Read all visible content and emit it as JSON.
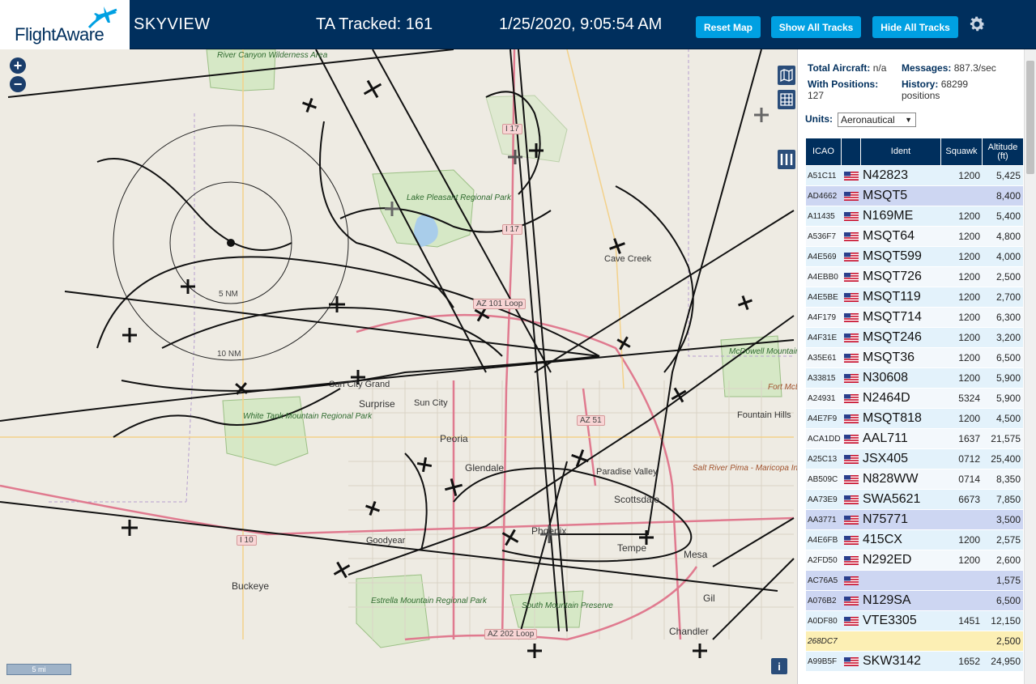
{
  "header": {
    "logo_text": "FlightAware",
    "app_title": "SKYVIEW",
    "tracked": "TA Tracked: 161",
    "clock": "1/25/2020, 9:05:54 AM",
    "reset_label": "Reset Map",
    "show_label": "Show All Tracks",
    "hide_label": "Hide All Tracks",
    "gear_icon": "gear-icon"
  },
  "map": {
    "zoom_in": "+",
    "zoom_out": "−",
    "scale": "5 mi",
    "info": "i",
    "cities": [
      "Surprise",
      "Sun City",
      "Peoria",
      "Glendale",
      "Paradise Valley",
      "Scottsdale",
      "Phoenix",
      "Tempe",
      "Mesa",
      "Goodyear",
      "Buckeye",
      "Chandler",
      "Sun City Grand",
      "Fountain Hills",
      "Cave Creek",
      "Gil"
    ],
    "parks": [
      "River Canyon Wilderness Area",
      "Lake Pleasant Regional Park",
      "White Tank Mountain Regional Park",
      "Estrella Mountain Regional Park",
      "South Mountain Preserve",
      "McDowell Mountain Regional Park",
      "Salt River Pima - Maricopa Indian Community",
      "Fort McDowell Yavapai Nation"
    ],
    "roads": [
      "I 17",
      "I 17",
      "I 10",
      "AZ 51",
      "AZ 101 Loop",
      "AZ 202 Loop"
    ],
    "range_labels": [
      "5 NM",
      "10 NM"
    ]
  },
  "panel": {
    "total_aircraft_label": "Total Aircraft:",
    "total_aircraft_value": "n/a",
    "messages_label": "Messages:",
    "messages_value": "887.3/sec",
    "with_positions_label": "With Positions:",
    "with_positions_value": "127",
    "history_label": "History:",
    "history_value": "68299 positions",
    "units_label": "Units:",
    "units_value": "Aeronautical",
    "columns": [
      "ICAO",
      "",
      "Ident",
      "Squawk",
      "Altitude (ft)"
    ]
  },
  "rows": [
    {
      "icao": "A51C11",
      "flag": true,
      "ident": "N42823",
      "squawk": "1200",
      "alt": "5,425",
      "style": "light"
    },
    {
      "icao": "AD4662",
      "flag": true,
      "ident": "MSQT5",
      "squawk": "",
      "alt": "8,400",
      "style": "blue"
    },
    {
      "icao": "A11435",
      "flag": true,
      "ident": "N169ME",
      "squawk": "1200",
      "alt": "5,400",
      "style": "light"
    },
    {
      "icao": "A536F7",
      "flag": true,
      "ident": "MSQT64",
      "squawk": "1200",
      "alt": "4,800",
      "style": "white"
    },
    {
      "icao": "A4E569",
      "flag": true,
      "ident": "MSQT599",
      "squawk": "1200",
      "alt": "4,000",
      "style": "light"
    },
    {
      "icao": "A4EBB0",
      "flag": true,
      "ident": "MSQT726",
      "squawk": "1200",
      "alt": "2,500",
      "style": "white"
    },
    {
      "icao": "A4E5BE",
      "flag": true,
      "ident": "MSQT119",
      "squawk": "1200",
      "alt": "2,700",
      "style": "light"
    },
    {
      "icao": "A4F179",
      "flag": true,
      "ident": "MSQT714",
      "squawk": "1200",
      "alt": "6,300",
      "style": "white"
    },
    {
      "icao": "A4F31E",
      "flag": true,
      "ident": "MSQT246",
      "squawk": "1200",
      "alt": "3,200",
      "style": "light"
    },
    {
      "icao": "A35E61",
      "flag": true,
      "ident": "MSQT36",
      "squawk": "1200",
      "alt": "6,500",
      "style": "white"
    },
    {
      "icao": "A33815",
      "flag": true,
      "ident": "N30608",
      "squawk": "1200",
      "alt": "5,900",
      "style": "light"
    },
    {
      "icao": "A24931",
      "flag": true,
      "ident": "N2464D",
      "squawk": "5324",
      "alt": "5,900",
      "style": "white"
    },
    {
      "icao": "A4E7F9",
      "flag": true,
      "ident": "MSQT818",
      "squawk": "1200",
      "alt": "4,500",
      "style": "light"
    },
    {
      "icao": "ACA1DD",
      "flag": true,
      "ident": "AAL711",
      "squawk": "1637",
      "alt": "21,575",
      "style": "white"
    },
    {
      "icao": "A25C13",
      "flag": true,
      "ident": "JSX405",
      "squawk": "0712",
      "alt": "25,400",
      "style": "light"
    },
    {
      "icao": "AB509C",
      "flag": true,
      "ident": "N828WW",
      "squawk": "0714",
      "alt": "8,350",
      "style": "white"
    },
    {
      "icao": "AA73E9",
      "flag": true,
      "ident": "SWA5621",
      "squawk": "6673",
      "alt": "7,850",
      "style": "light"
    },
    {
      "icao": "AA3771",
      "flag": true,
      "ident": "N75771",
      "squawk": "",
      "alt": "3,500",
      "style": "blue"
    },
    {
      "icao": "A4E6FB",
      "flag": true,
      "ident": "415CX",
      "squawk": "1200",
      "alt": "2,575",
      "style": "light"
    },
    {
      "icao": "A2FD50",
      "flag": true,
      "ident": "N292ED",
      "squawk": "1200",
      "alt": "2,600",
      "style": "white"
    },
    {
      "icao": "AC76A5",
      "flag": true,
      "ident": "",
      "squawk": "",
      "alt": "1,575",
      "style": "blue"
    },
    {
      "icao": "A076B2",
      "flag": true,
      "ident": "N129SA",
      "squawk": "",
      "alt": "6,500",
      "style": "blue"
    },
    {
      "icao": "A0DF80",
      "flag": true,
      "ident": "VTE3305",
      "squawk": "1451",
      "alt": "12,150",
      "style": "light"
    },
    {
      "icao": "268DC7",
      "flag": false,
      "ident": "",
      "squawk": "",
      "alt": "2,500",
      "style": "yellow"
    },
    {
      "icao": "A99B5F",
      "flag": true,
      "ident": "SKW3142",
      "squawk": "1652",
      "alt": "24,950",
      "style": "light"
    }
  ],
  "colors": {
    "header_bg": "#002f5d",
    "button_bg": "#00a0e2",
    "map_bg": "#eeebe3",
    "park_green": "#d6e8c6",
    "road_pink": "#e07a8f",
    "track_black": "#111111"
  }
}
